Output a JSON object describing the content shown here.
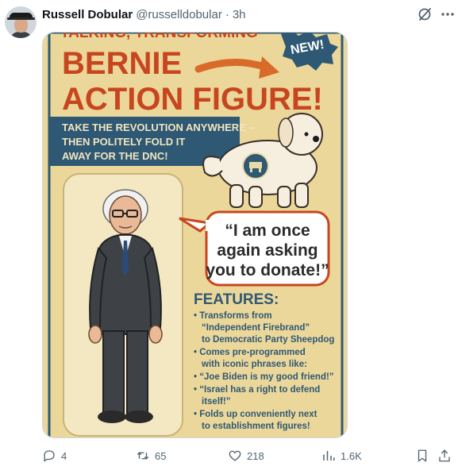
{
  "tweet": {
    "display_name": "Russell Dobular",
    "handle": "@russelldobular",
    "separator": "·",
    "time": "3h"
  },
  "image": {
    "top_text": "TALKING, TRANSFORMING",
    "badge": "NEW!",
    "title_line1": "BERNIE",
    "title_line2": "ACTION FIGURE!",
    "tagline_line1": "TAKE THE REVOLUTION ANYWHERE –",
    "tagline_line2": "THEN POLITELY FOLD IT",
    "tagline_line3": "AWAY FOR THE DNC!",
    "quote_line1": "“I am once",
    "quote_line2": "again asking",
    "quote_line3": "you to donate!”",
    "features_heading": "FEATURES:",
    "features": [
      "• Transforms from",
      "“Independent Firebrand”",
      "to Democratic Party Sheepdog",
      "• Comes pre-programmed",
      "with iconic phrases like:",
      "• “Joe Biden is my good friend!”",
      "• “Israel has a right to defend",
      "itself!”",
      "• Folds up conveniently next",
      "to establishment figures!"
    ],
    "colors": {
      "card": "#ecd79a",
      "red": "#c7461f",
      "blue_band": "#2e5874",
      "border": "#2b5a74"
    }
  },
  "actions": {
    "replies": "4",
    "reposts": "65",
    "likes": "218",
    "views": "1.6K"
  },
  "icons": [
    "grok-icon",
    "more-icon",
    "reply-icon",
    "repost-icon",
    "like-icon",
    "views-icon",
    "bookmark-icon",
    "share-icon"
  ]
}
